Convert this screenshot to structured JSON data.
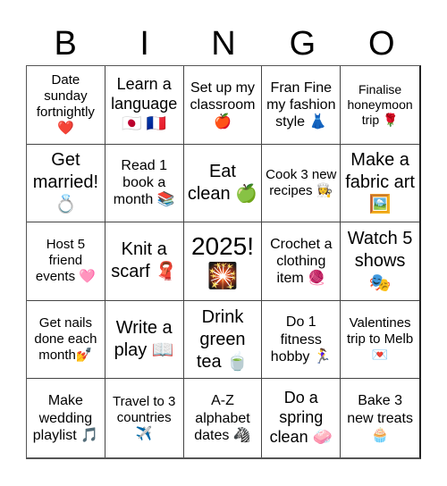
{
  "header": {
    "letters": [
      "B",
      "I",
      "N",
      "G",
      "O"
    ]
  },
  "cells": [
    {
      "text": "Date sunday fortnightly ❤️",
      "icon": "red-heart-icon"
    },
    {
      "text": "Learn a language 🇯🇵 🇫🇷",
      "icon": "japan-france-flags-icon"
    },
    {
      "text": "Set up my classroom 🍎",
      "icon": "red-apple-icon"
    },
    {
      "text": "Fran Fine my fashion style 👗",
      "icon": "dress-icon"
    },
    {
      "text": "Finalise honeymoon trip 🌹",
      "icon": "rose-icon"
    },
    {
      "text": "Get married! 💍",
      "icon": "ring-icon"
    },
    {
      "text": "Read 1 book a month 📚",
      "icon": "books-icon"
    },
    {
      "text": "Eat clean 🍏",
      "icon": "green-apple-icon"
    },
    {
      "text": "Cook 3 new recipes 👩‍🍳",
      "icon": "cook-icon"
    },
    {
      "text": "Make a fabric art 🖼️",
      "icon": "framed-picture-icon"
    },
    {
      "text": "Host 5 friend events 🩷",
      "icon": "pink-heart-icon"
    },
    {
      "text": "Knit a scarf 🧣",
      "icon": "scarf-icon"
    },
    {
      "text": "2025! 🎇",
      "icon": "sparkler-icon"
    },
    {
      "text": "Crochet a clothing item 🧶",
      "icon": "yarn-icon"
    },
    {
      "text": "Watch 5 shows 🎭",
      "icon": "theater-masks-icon"
    },
    {
      "text": "Get nails done each month💅",
      "icon": "nail-polish-icon"
    },
    {
      "text": "Write a play 📖",
      "icon": "open-book-icon"
    },
    {
      "text": "Drink green tea 🍵",
      "icon": "tea-icon"
    },
    {
      "text": "Do 1 fitness hobby 🏃‍♀️",
      "icon": "runner-icon"
    },
    {
      "text": "Valentines trip to Melb 💌",
      "icon": "love-letter-icon"
    },
    {
      "text": "Make wedding playlist 🎵",
      "icon": "music-note-icon"
    },
    {
      "text": "Travel to 3 countries ✈️",
      "icon": "airplane-icon"
    },
    {
      "text": "A-Z alphabet dates 🦓",
      "icon": "zebra-icon"
    },
    {
      "text": "Do a spring clean 🧼",
      "icon": "soap-icon"
    },
    {
      "text": "Bake 3 new treats 🧁",
      "icon": "cupcake-icon"
    }
  ]
}
